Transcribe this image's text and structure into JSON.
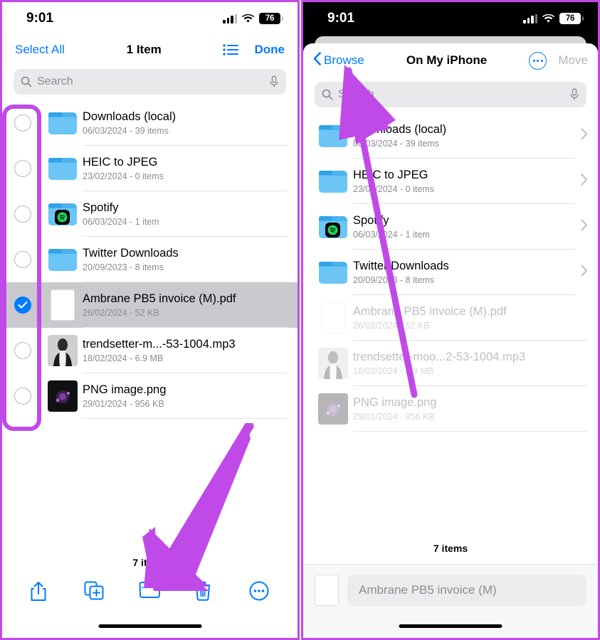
{
  "status_bar": {
    "time": "9:01",
    "battery": "76",
    "signal_icon": "cellular-signal-icon",
    "wifi_icon": "wifi-icon",
    "battery_icon": "battery-icon"
  },
  "left_phone": {
    "nav": {
      "select_all": "Select All",
      "title": "1 Item",
      "view_toggle_icon": "list-view-icon",
      "done": "Done"
    },
    "search": {
      "placeholder": "Search",
      "search_icon": "search-icon",
      "mic_icon": "microphone-icon"
    },
    "items": [
      {
        "name": "Downloads (local)",
        "meta": "06/03/2024 - 39 items",
        "kind": "folder",
        "checked": false
      },
      {
        "name": "HEIC to JPEG",
        "meta": "23/02/2024 - 0 items",
        "kind": "folder",
        "checked": false
      },
      {
        "name": "Spotify",
        "meta": "06/03/2024 - 1 item",
        "kind": "folder-spotify",
        "checked": false
      },
      {
        "name": "Twitter Downloads",
        "meta": "20/09/2023 - 8 items",
        "kind": "folder",
        "checked": false
      },
      {
        "name": "Ambrane PB5 invoice (M).pdf",
        "meta": "26/02/2024 - 52 KB",
        "kind": "pdf",
        "checked": true
      },
      {
        "name": "trendsetter-m...-53-1004.mp3",
        "meta": "18/02/2024 - 6.9 MB",
        "kind": "audio",
        "checked": false
      },
      {
        "name": "PNG image.png",
        "meta": "29/01/2024 - 956 KB",
        "kind": "image",
        "checked": false
      }
    ],
    "count": "7 items",
    "toolbar": [
      {
        "label": "share-icon"
      },
      {
        "label": "duplicate-icon"
      },
      {
        "label": "move-to-folder-icon"
      },
      {
        "label": "delete-icon"
      },
      {
        "label": "more-icon"
      }
    ]
  },
  "right_phone": {
    "nav": {
      "back": "Browse",
      "back_icon": "chevron-left-icon",
      "title": "On My iPhone",
      "more_icon": "more-icon",
      "move": "Move"
    },
    "search": {
      "placeholder": "Search",
      "search_icon": "search-icon",
      "mic_icon": "microphone-icon"
    },
    "items": [
      {
        "name": "Downloads (local)",
        "meta": "06/03/2024 - 39 items",
        "kind": "folder",
        "dim": false
      },
      {
        "name": "HEIC to JPEG",
        "meta": "23/02/2024 - 0 items",
        "kind": "folder",
        "dim": false
      },
      {
        "name": "Spotify",
        "meta": "06/03/2024 - 1 item",
        "kind": "folder-spotify",
        "dim": false
      },
      {
        "name": "Twitter Downloads",
        "meta": "20/09/2023 - 8 items",
        "kind": "folder",
        "dim": false
      },
      {
        "name": "Ambrane PB5 invoice (M).pdf",
        "meta": "26/02/2024 - 52 KB",
        "kind": "pdf",
        "dim": true
      },
      {
        "name": "trendsetter-moo...2-53-1004.mp3",
        "meta": "18/02/2024 - 6.9 MB",
        "kind": "audio",
        "dim": true
      },
      {
        "name": "PNG image.png",
        "meta": "29/01/2024 - 956 KB",
        "kind": "image",
        "dim": true
      }
    ],
    "count": "7 items",
    "filename_field": "Ambrane PB5 invoice (M)"
  },
  "annotations": {
    "accent_color": "#c04ae8",
    "checkbox_column_highlight": "rounded-rectangle",
    "arrow_left": "points to move-to-folder-icon",
    "arrow_right": "points to Browse back button"
  }
}
